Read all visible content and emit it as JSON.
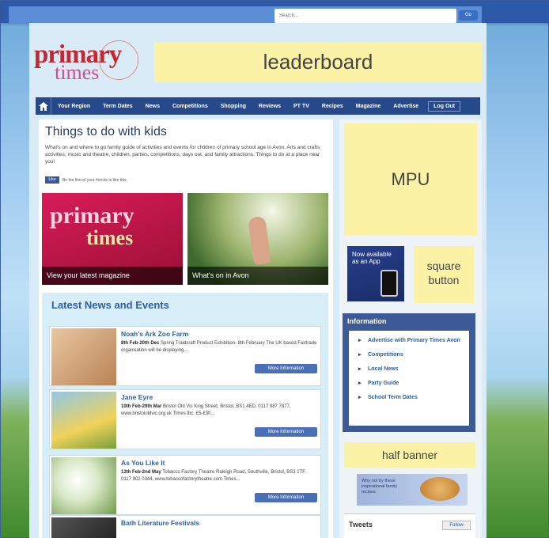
{
  "topbar": {
    "search_placeholder": "Search...",
    "go": "Go"
  },
  "logo": {
    "line1": "primary",
    "line2": "times"
  },
  "ads": {
    "leaderboard": "leaderboard",
    "mpu": "MPU",
    "square": "square button",
    "half": "half banner"
  },
  "nav": {
    "items": [
      "Your Region",
      "Term Dates",
      "News",
      "Competitions",
      "Shopping",
      "Reviews",
      "PT TV",
      "Recipes",
      "Magazine",
      "Advertise"
    ],
    "logout": "Log Out"
  },
  "main": {
    "title": "Things to do with kids",
    "intro": "What's on and where to go family guide of activities and events for children of primary school age in Avon. Arts and crafts activities, music and theatre, children, parties, competitions, days out, and family attractions. Things to do at a place near you!",
    "fb_like": "Like",
    "fb_text": "Be the first of your friends to like this.",
    "tile1_caption": "View your latest magazine",
    "tile1_big": "primary",
    "tile1_big2": "times",
    "tile2_caption": "What's on in Avon"
  },
  "news": {
    "heading": "Latest News and Events",
    "items": [
      {
        "title": "Noah's Ark Zoo Farm",
        "date": "8th Feb-20th Dec",
        "desc": "Spring Traidcraft Product Exhibition- 8th February The UK based Fairtrade organisation will be displaying...",
        "btn": "More Information"
      },
      {
        "title": "Jane Eyre",
        "date": "10th Feb-29th Mar",
        "desc": "Bristol Old Vic King Street, Bristol, BS1 4ED. 0117 987 7877, www.bristololdvic.org.uk Times tbc. £5-£30...",
        "btn": "More Information"
      },
      {
        "title": "As You Like It",
        "date": "13th Feb-2nd May",
        "desc": "Tobacco Factory Theatre Raleigh Road, Southville, Bristol, BS3 1TF. 0117 902 0344, www.tobaccofactorytheatre.com Times...",
        "btn": "More Information"
      },
      {
        "title": "Bath Literature Festivals",
        "date": "",
        "desc": "",
        "btn": ""
      }
    ]
  },
  "app": {
    "text": "Now available as an App"
  },
  "info": {
    "heading": "Information",
    "links": [
      "Advertise with Primary Times Avon",
      "Competitions",
      "Local News",
      "Party Guide",
      "School Term Dates"
    ]
  },
  "recipe": {
    "text": "Why not try these inspirational family recipes"
  },
  "tweets": {
    "label": "Tweets",
    "follow": "Follow"
  }
}
